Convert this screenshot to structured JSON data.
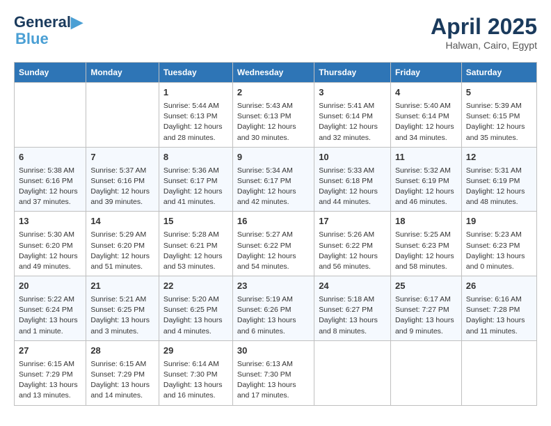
{
  "header": {
    "logo_line1": "General",
    "logo_line2": "Blue",
    "month": "April 2025",
    "location": "Halwan, Cairo, Egypt"
  },
  "days_of_week": [
    "Sunday",
    "Monday",
    "Tuesday",
    "Wednesday",
    "Thursday",
    "Friday",
    "Saturday"
  ],
  "weeks": [
    [
      {
        "day": "",
        "content": ""
      },
      {
        "day": "",
        "content": ""
      },
      {
        "day": "1",
        "content": "Sunrise: 5:44 AM\nSunset: 6:13 PM\nDaylight: 12 hours and 28 minutes."
      },
      {
        "day": "2",
        "content": "Sunrise: 5:43 AM\nSunset: 6:13 PM\nDaylight: 12 hours and 30 minutes."
      },
      {
        "day": "3",
        "content": "Sunrise: 5:41 AM\nSunset: 6:14 PM\nDaylight: 12 hours and 32 minutes."
      },
      {
        "day": "4",
        "content": "Sunrise: 5:40 AM\nSunset: 6:14 PM\nDaylight: 12 hours and 34 minutes."
      },
      {
        "day": "5",
        "content": "Sunrise: 5:39 AM\nSunset: 6:15 PM\nDaylight: 12 hours and 35 minutes."
      }
    ],
    [
      {
        "day": "6",
        "content": "Sunrise: 5:38 AM\nSunset: 6:16 PM\nDaylight: 12 hours and 37 minutes."
      },
      {
        "day": "7",
        "content": "Sunrise: 5:37 AM\nSunset: 6:16 PM\nDaylight: 12 hours and 39 minutes."
      },
      {
        "day": "8",
        "content": "Sunrise: 5:36 AM\nSunset: 6:17 PM\nDaylight: 12 hours and 41 minutes."
      },
      {
        "day": "9",
        "content": "Sunrise: 5:34 AM\nSunset: 6:17 PM\nDaylight: 12 hours and 42 minutes."
      },
      {
        "day": "10",
        "content": "Sunrise: 5:33 AM\nSunset: 6:18 PM\nDaylight: 12 hours and 44 minutes."
      },
      {
        "day": "11",
        "content": "Sunrise: 5:32 AM\nSunset: 6:19 PM\nDaylight: 12 hours and 46 minutes."
      },
      {
        "day": "12",
        "content": "Sunrise: 5:31 AM\nSunset: 6:19 PM\nDaylight: 12 hours and 48 minutes."
      }
    ],
    [
      {
        "day": "13",
        "content": "Sunrise: 5:30 AM\nSunset: 6:20 PM\nDaylight: 12 hours and 49 minutes."
      },
      {
        "day": "14",
        "content": "Sunrise: 5:29 AM\nSunset: 6:20 PM\nDaylight: 12 hours and 51 minutes."
      },
      {
        "day": "15",
        "content": "Sunrise: 5:28 AM\nSunset: 6:21 PM\nDaylight: 12 hours and 53 minutes."
      },
      {
        "day": "16",
        "content": "Sunrise: 5:27 AM\nSunset: 6:22 PM\nDaylight: 12 hours and 54 minutes."
      },
      {
        "day": "17",
        "content": "Sunrise: 5:26 AM\nSunset: 6:22 PM\nDaylight: 12 hours and 56 minutes."
      },
      {
        "day": "18",
        "content": "Sunrise: 5:25 AM\nSunset: 6:23 PM\nDaylight: 12 hours and 58 minutes."
      },
      {
        "day": "19",
        "content": "Sunrise: 5:23 AM\nSunset: 6:23 PM\nDaylight: 13 hours and 0 minutes."
      }
    ],
    [
      {
        "day": "20",
        "content": "Sunrise: 5:22 AM\nSunset: 6:24 PM\nDaylight: 13 hours and 1 minute."
      },
      {
        "day": "21",
        "content": "Sunrise: 5:21 AM\nSunset: 6:25 PM\nDaylight: 13 hours and 3 minutes."
      },
      {
        "day": "22",
        "content": "Sunrise: 5:20 AM\nSunset: 6:25 PM\nDaylight: 13 hours and 4 minutes."
      },
      {
        "day": "23",
        "content": "Sunrise: 5:19 AM\nSunset: 6:26 PM\nDaylight: 13 hours and 6 minutes."
      },
      {
        "day": "24",
        "content": "Sunrise: 5:18 AM\nSunset: 6:27 PM\nDaylight: 13 hours and 8 minutes."
      },
      {
        "day": "25",
        "content": "Sunrise: 6:17 AM\nSunset: 7:27 PM\nDaylight: 13 hours and 9 minutes."
      },
      {
        "day": "26",
        "content": "Sunrise: 6:16 AM\nSunset: 7:28 PM\nDaylight: 13 hours and 11 minutes."
      }
    ],
    [
      {
        "day": "27",
        "content": "Sunrise: 6:15 AM\nSunset: 7:29 PM\nDaylight: 13 hours and 13 minutes."
      },
      {
        "day": "28",
        "content": "Sunrise: 6:15 AM\nSunset: 7:29 PM\nDaylight: 13 hours and 14 minutes."
      },
      {
        "day": "29",
        "content": "Sunrise: 6:14 AM\nSunset: 7:30 PM\nDaylight: 13 hours and 16 minutes."
      },
      {
        "day": "30",
        "content": "Sunrise: 6:13 AM\nSunset: 7:30 PM\nDaylight: 13 hours and 17 minutes."
      },
      {
        "day": "",
        "content": ""
      },
      {
        "day": "",
        "content": ""
      },
      {
        "day": "",
        "content": ""
      }
    ]
  ]
}
